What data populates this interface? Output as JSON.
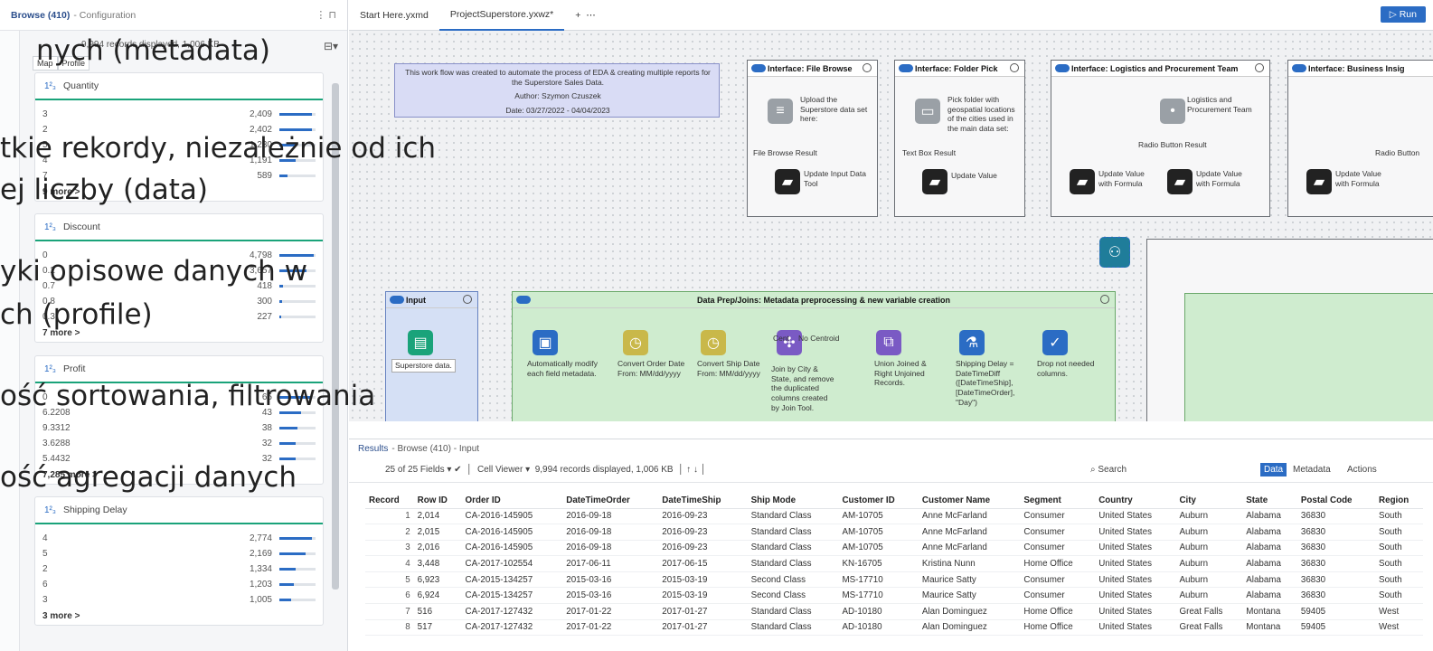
{
  "left": {
    "title": "Browse (410)",
    "subtitle": "- Configuration",
    "records": "9,994 records displayed, 1,006 KB",
    "tab_map": "Map",
    "tab_profile": "Profile",
    "cards": [
      {
        "name": "Quantity",
        "rows": [
          [
            "3",
            "2,409",
            0.9
          ],
          [
            "2",
            "2,402",
            0.9
          ],
          [
            "5",
            "1,230",
            0.45
          ],
          [
            "4",
            "1,191",
            0.45
          ],
          [
            "7",
            "589",
            0.22
          ]
        ],
        "more": "9 more >"
      },
      {
        "name": "Discount",
        "rows": [
          [
            "0",
            "4,798",
            0.95
          ],
          [
            "0.2",
            "3,657",
            0.75
          ],
          [
            "0.7",
            "418",
            0.1
          ],
          [
            "0.8",
            "300",
            0.07
          ],
          [
            "0.3",
            "227",
            0.05
          ]
        ],
        "more": "7 more >"
      },
      {
        "name": "Profit",
        "rows": [
          [
            "0",
            "65",
            0.9
          ],
          [
            "6.2208",
            "43",
            0.6
          ],
          [
            "9.3312",
            "38",
            0.5
          ],
          [
            "3.6288",
            "32",
            0.45
          ],
          [
            "5.4432",
            "32",
            0.45
          ]
        ],
        "more": "7,285 more >"
      },
      {
        "name": "Shipping Delay",
        "rows": [
          [
            "4",
            "2,774",
            0.9
          ],
          [
            "5",
            "2,169",
            0.72
          ],
          [
            "2",
            "1,334",
            0.45
          ],
          [
            "6",
            "1,203",
            0.4
          ],
          [
            "3",
            "1,005",
            0.33
          ]
        ],
        "more": "3 more >"
      }
    ]
  },
  "slide": [
    "nych (metadata)",
    "tkie rekordy, niezależnie od ich",
    "ej liczby (data)",
    "yki opisowe danych w",
    "ch (profile)",
    "ość sortowania, filtrowania",
    "ość agregacji danych"
  ],
  "tabs": [
    "Start Here.yxmd",
    "ProjectSuperstore.yxwz*"
  ],
  "run": "▷ Run",
  "canvas": {
    "desc": [
      "This work flow was created to automate the process of EDA & creating multiple reports for the Superstore Sales Data.",
      "Author: Szymon Czuszek",
      "Date: 03/27/2022 - 04/04/2023"
    ],
    "boxes": [
      "Interface: File Browse",
      "Interface: Folder Pick",
      "Interface: Logistics and Procurement Team",
      "Interface: Business Insig",
      "Input",
      "Data Prep/Joins: Metadata preprocessing & new variable creation"
    ],
    "n1": "Upload the Superstore data set here:",
    "n2": "Pick folder with geospatial locations of the cities used in the main data set:",
    "n3": "Logistics and Procurement Team",
    "fbr": "File Browse Result",
    "tbr": "Text Box Result",
    "rbr": "Radio Button Result",
    "rbr2": "Radio Button",
    "uid": "Update Input Data Tool",
    "uv": "Update Value",
    "uvf": "Update Value with Formula",
    "sd": "Superstore data.",
    "am": "Automatically modify each field metadata.",
    "co": "Convert Order Date From: MM/dd/yyyy",
    "cs": "Convert Ship Date From: MM/dd/yyyy",
    "jn": "Join by City & State, and remove the duplicated columns created by Join Tool.",
    "un": "Union Joined & Right Unjoined Records.",
    "sh": "Shipping Delay = DateTimeDiff ([DateTimeShip], [DateTimeOrder], \"Day\")",
    "dr": "Drop not needed columns.",
    "cent": "Cent",
    "noc": "No Centroid"
  },
  "results": {
    "title": "Results",
    "sub": "- Browse (410) - Input",
    "fields": "25 of 25 Fields",
    "viewer": "Cell Viewer",
    "recs": "9,994 records displayed, 1,006 KB",
    "search": "Search",
    "data": "Data",
    "meta": "Metadata",
    "actions": "Actions",
    "cols": [
      "Record",
      "Row ID",
      "Order ID",
      "DateTimeOrder",
      "DateTimeShip",
      "Ship Mode",
      "Customer ID",
      "Customer Name",
      "Segment",
      "Country",
      "City",
      "State",
      "Postal Code",
      "Region"
    ],
    "rows": [
      [
        "1",
        "2,014",
        "CA-2016-145905",
        "2016-09-18",
        "2016-09-23",
        "Standard Class",
        "AM-10705",
        "Anne McFarland",
        "Consumer",
        "United States",
        "Auburn",
        "Alabama",
        "36830",
        "South"
      ],
      [
        "2",
        "2,015",
        "CA-2016-145905",
        "2016-09-18",
        "2016-09-23",
        "Standard Class",
        "AM-10705",
        "Anne McFarland",
        "Consumer",
        "United States",
        "Auburn",
        "Alabama",
        "36830",
        "South"
      ],
      [
        "3",
        "2,016",
        "CA-2016-145905",
        "2016-09-18",
        "2016-09-23",
        "Standard Class",
        "AM-10705",
        "Anne McFarland",
        "Consumer",
        "United States",
        "Auburn",
        "Alabama",
        "36830",
        "South"
      ],
      [
        "4",
        "3,448",
        "CA-2017-102554",
        "2017-06-11",
        "2017-06-15",
        "Standard Class",
        "KN-16705",
        "Kristina Nunn",
        "Home Office",
        "United States",
        "Auburn",
        "Alabama",
        "36830",
        "South"
      ],
      [
        "5",
        "6,923",
        "CA-2015-134257",
        "2015-03-16",
        "2015-03-19",
        "Second Class",
        "MS-17710",
        "Maurice Satty",
        "Consumer",
        "United States",
        "Auburn",
        "Alabama",
        "36830",
        "South"
      ],
      [
        "6",
        "6,924",
        "CA-2015-134257",
        "2015-03-16",
        "2015-03-19",
        "Second Class",
        "MS-17710",
        "Maurice Satty",
        "Consumer",
        "United States",
        "Auburn",
        "Alabama",
        "36830",
        "South"
      ],
      [
        "7",
        "516",
        "CA-2017-127432",
        "2017-01-22",
        "2017-01-27",
        "Standard Class",
        "AD-10180",
        "Alan Dominguez",
        "Home Office",
        "United States",
        "Great Falls",
        "Montana",
        "59405",
        "West"
      ],
      [
        "8",
        "517",
        "CA-2017-127432",
        "2017-01-22",
        "2017-01-27",
        "Standard Class",
        "AD-10180",
        "Alan Dominguez",
        "Home Office",
        "United States",
        "Great Falls",
        "Montana",
        "59405",
        "West"
      ]
    ]
  }
}
